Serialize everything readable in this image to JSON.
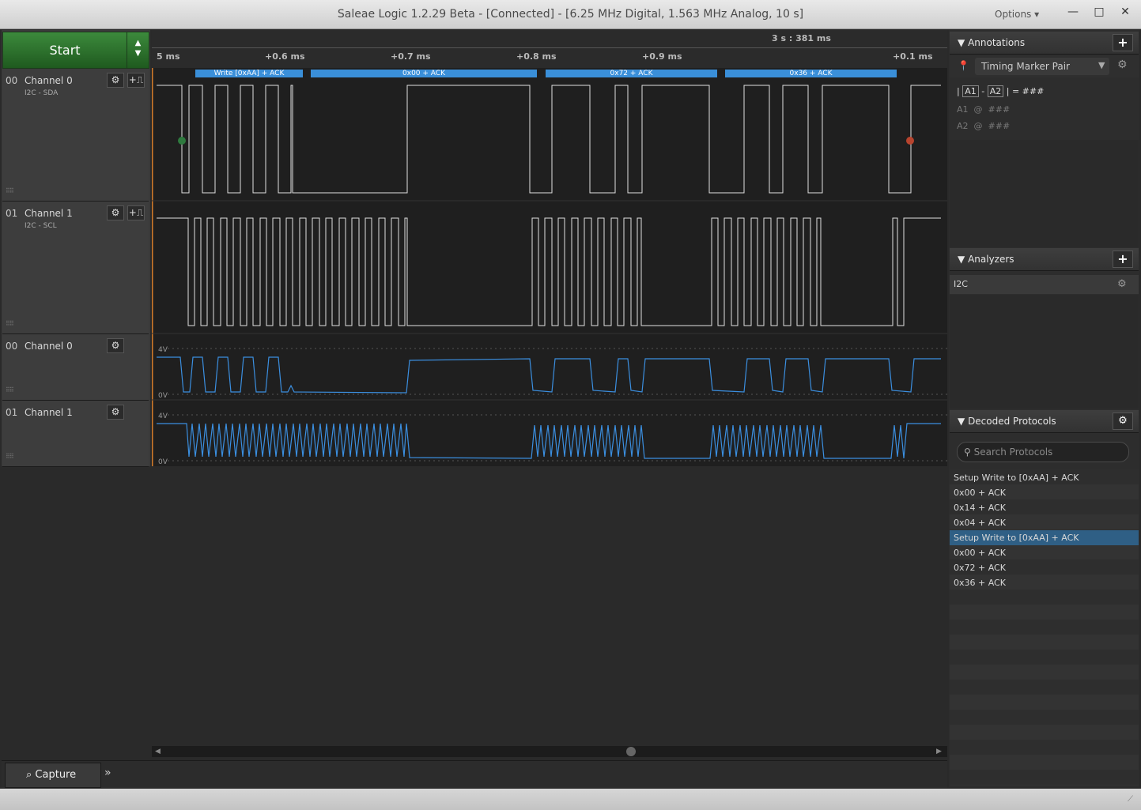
{
  "window": {
    "title": "Saleae Logic 1.2.29 Beta - [Connected] - [6.25 MHz Digital, 1.563 MHz Analog, 10 s]",
    "options_label": "Options",
    "min": "—",
    "max": "□",
    "close": "✕"
  },
  "start_label": "Start",
  "channels": [
    {
      "num": "00",
      "name": "Channel 0",
      "sub": "I2C - SDA"
    },
    {
      "num": "01",
      "name": "Channel 1",
      "sub": "I2C - SCL"
    },
    {
      "num": "00",
      "name": "Channel 0"
    },
    {
      "num": "01",
      "name": "Channel 1"
    }
  ],
  "analog_labels": {
    "high": "4V",
    "low": "0V"
  },
  "ruler": {
    "top_marker": "3 s : 381 ms",
    "ticks": [
      "5 ms",
      "+0.6 ms",
      "+0.7 ms",
      "+0.8 ms",
      "+0.9 ms",
      "+0.1 ms"
    ]
  },
  "protocol_bubbles": [
    "Write [0xAA] + ACK",
    "0x00 + ACK",
    "0x72 + ACK",
    "0x36 + ACK"
  ],
  "bottom": {
    "capture_tab": "Capture",
    "more": "»"
  },
  "annotations": {
    "title": "Annotations",
    "marker_type": "Timing Marker Pair",
    "a1": "A1",
    "a2": "A2",
    "diff_value": "###",
    "at": "@",
    "a1_value": "###",
    "a2_value": "###",
    "eq": "="
  },
  "analyzers": {
    "title": "Analyzers",
    "items": [
      "I2C"
    ]
  },
  "decoded": {
    "title": "Decoded Protocols",
    "search_placeholder": "Search Protocols",
    "rows": [
      "Setup Write to [0xAA] + ACK",
      "0x00 + ACK",
      "0x14 + ACK",
      "0x04 + ACK",
      "Setup Write to [0xAA] + ACK",
      "0x00 + ACK",
      "0x72 + ACK",
      "0x36 + ACK"
    ],
    "selected_index": 4
  },
  "colors": {
    "accent": "#3a8fd9",
    "start_green": "#2e7a2e",
    "wave_line": "#e0e0e0",
    "analog_line": "#3b8fe0"
  }
}
